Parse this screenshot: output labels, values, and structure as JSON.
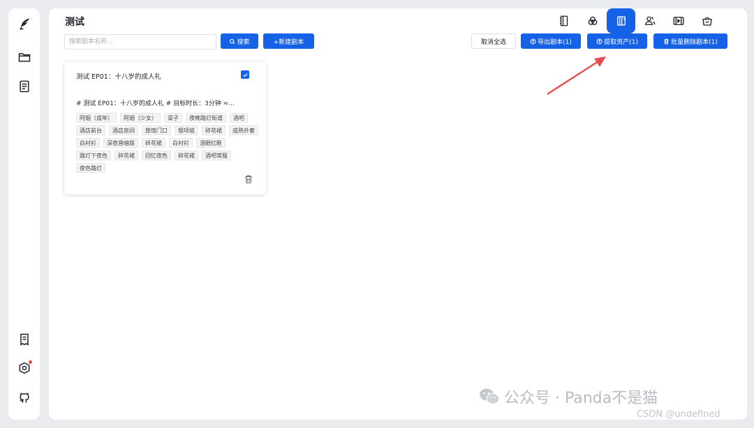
{
  "page": {
    "title": "测试"
  },
  "search": {
    "placeholder": "搜索剧本名称...",
    "button_label": "搜索"
  },
  "toolbar": {
    "new_script_label": "+新建剧本",
    "cancel_select_label": "取消全选",
    "export_label": "导出剧本(1)",
    "extract_assets_label": "提取资产(1)",
    "batch_delete_label": "批量删除剧本(1)"
  },
  "tabs": [
    {
      "icon": "notebook-icon",
      "active": false
    },
    {
      "icon": "circles-icon",
      "active": false
    },
    {
      "icon": "script-book-icon",
      "active": true
    },
    {
      "icon": "users-icon",
      "active": false
    },
    {
      "icon": "video-icon",
      "active": false
    },
    {
      "icon": "bag-icon",
      "active": false
    }
  ],
  "sidebar": {
    "items": [
      {
        "icon": "quill-logo-icon"
      },
      {
        "icon": "folder-icon"
      },
      {
        "icon": "document-list-icon"
      },
      {
        "icon": "receipt-icon"
      },
      {
        "icon": "settings-hex-icon",
        "has_notification": true
      },
      {
        "icon": "github-icon"
      }
    ]
  },
  "script_cards": [
    {
      "title": "测试 EP01：十八岁的成人礼",
      "checked": true,
      "summary": "# 测试 EP01：十八岁的成人礼 # 目标时长：3分钟 ≈...",
      "tags": [
        "阿烟（成年）",
        "阿烟（少女）",
        "梁子",
        "夜晚路灯街道",
        "酒吧",
        "酒店前台",
        "酒店房间",
        "旅馆门口",
        "银项链",
        "碎花裙",
        "成熟外套",
        "白衬衫",
        "深夜昏暗版",
        "碎花裙",
        "白衬衫",
        "泪眼红眶",
        "路灯下夜色",
        "碎花裙",
        "回忆夜色",
        "碎花裙",
        "酒吧常服",
        "夜色路灯"
      ]
    }
  ],
  "watermarks": {
    "wechat": "公众号 · Panda不是猫",
    "csdn": "CSDN @undefined"
  },
  "colors": {
    "primary": "#1662e6",
    "annotation_arrow": "#e84c4c",
    "panel_bg": "#ffffff",
    "page_bg": "#e9ebef"
  }
}
